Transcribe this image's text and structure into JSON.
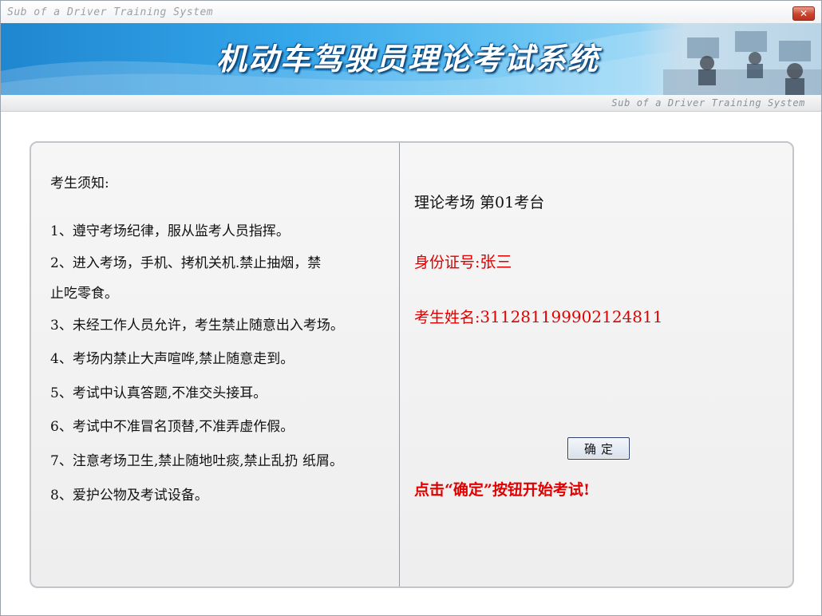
{
  "window": {
    "title": "Sub of a Driver Training System",
    "close_label": "✕"
  },
  "banner": {
    "title": "机动车驾驶员理论考试系统",
    "subtitle": "Sub of a Driver Training System"
  },
  "notice": {
    "heading": "考生须知:",
    "rules": [
      "1、遵守考场纪律，服从监考人员指挥。",
      "2、进入考场，手机、拷机关机.禁止抽烟，禁",
      "止吃零食。",
      "3、未经工作人员允许，考生禁止随意出入考场。",
      "4、考场内禁止大声喧哗,禁止随意走到。",
      "5、考试中认真答题,不准交头接耳。",
      "6、考试中不准冒名顶替,不准弄虚作假。",
      "7、注意考场卫生,禁止随地吐痰,禁止乱扔 纸屑。",
      "8、爱护公物及考试设备。"
    ]
  },
  "exam": {
    "room": "理论考场 第01考台",
    "id_label": "身份证号:",
    "id_value": "张三",
    "name_label": "考生姓名:",
    "name_value": "311281199902124811",
    "confirm_label": "确定",
    "hint": "点击“确定”按钮开始考试!"
  },
  "colors": {
    "accent_red": "#e00000",
    "banner_blue": "#1f86d0"
  }
}
